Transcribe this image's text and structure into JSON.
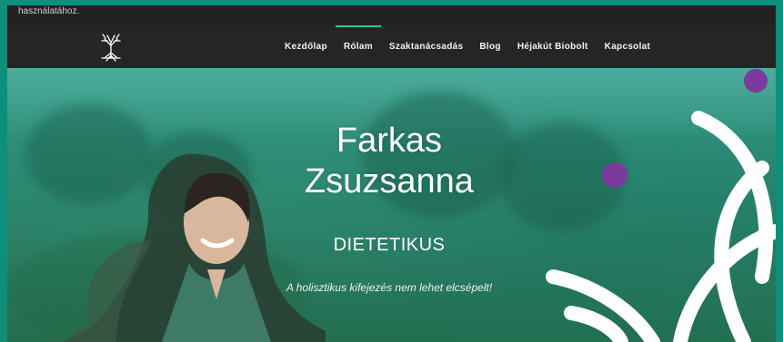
{
  "cookie_bar": {
    "text": "használatához."
  },
  "header": {
    "logo_icon": "tree-logo-icon",
    "nav_items": [
      {
        "label": "Kezdőlap",
        "active": false
      },
      {
        "label": "Rólam",
        "active": true
      },
      {
        "label": "Szaktanácsadás",
        "active": false
      },
      {
        "label": "Blog",
        "active": false
      },
      {
        "label": "Héjakút Biobolt",
        "active": false
      },
      {
        "label": "Kapcsolat",
        "active": false
      }
    ]
  },
  "hero": {
    "title": "Farkas Zsuzsanna",
    "subtitle": "DIETETIKUS",
    "tagline": "A holisztikus kifejezés nem lehet elcsépelt!"
  },
  "colors": {
    "accent": "#33c0a8",
    "page_border": "#0e8f7c",
    "navbar": "#252525",
    "decor_dot": "#7b3a9e",
    "decor_shape": "#ffffff"
  }
}
